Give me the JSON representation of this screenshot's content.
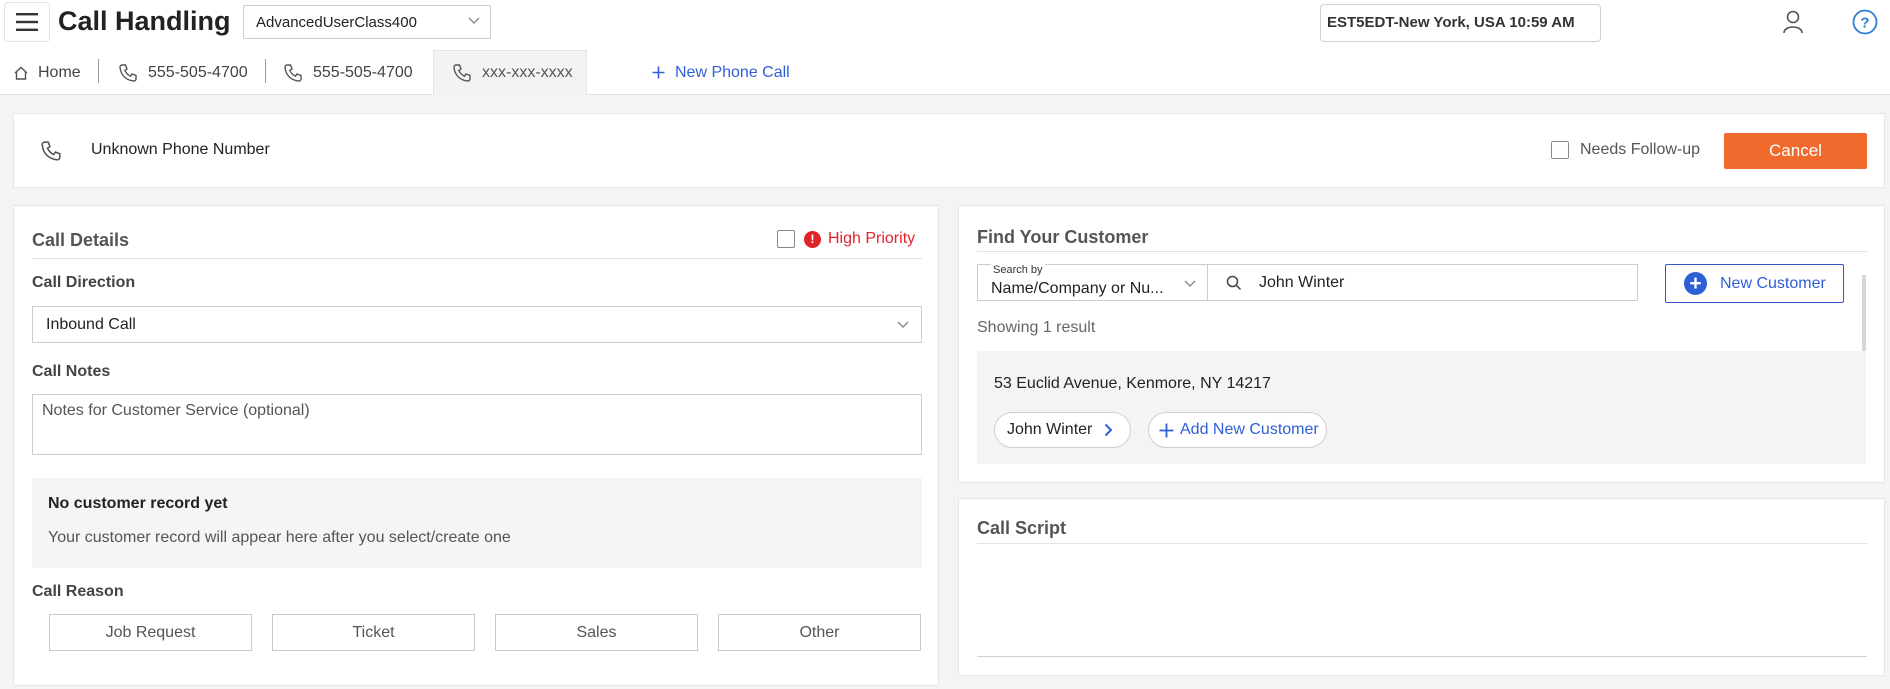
{
  "app": {
    "title": "Call Handling",
    "user_select": "AdvancedUserClass400",
    "timezone": "EST5EDT-New York, USA 10:59 AM"
  },
  "tabs": [
    {
      "label": "Home",
      "icon": "home-icon"
    },
    {
      "label": "555-505-4700",
      "icon": "phone-icon"
    },
    {
      "label": "555-505-4700",
      "icon": "phone-icon"
    },
    {
      "label": "xxx-xxx-xxxx",
      "icon": "phone-icon"
    }
  ],
  "new_call_label": "New Phone Call",
  "phone_bar": {
    "number_label": "Unknown Phone Number",
    "needs_followup_label": "Needs Follow-up",
    "cancel_label": "Cancel"
  },
  "call_details": {
    "title": "Call Details",
    "high_priority_label": "High Priority",
    "direction_label": "Call Direction",
    "direction_value": "Inbound Call",
    "notes_label": "Call Notes",
    "notes_placeholder": "Notes for Customer Service (optional)",
    "empty_title": "No customer record yet",
    "empty_text": "Your customer record will appear here after you select/create one",
    "reason_label": "Call Reason",
    "reasons": [
      "Job Request",
      "Ticket",
      "Sales",
      "Other"
    ]
  },
  "find_customer": {
    "title": "Find Your Customer",
    "search_by_caption": "Search by",
    "search_by_value": "Name/Company or Nu...",
    "search_value": "John Winter",
    "new_customer_label": "New Customer",
    "showing": "Showing 1 result",
    "result": {
      "address": "53 Euclid Avenue, Kenmore, NY 14217",
      "contact": "John Winter",
      "add_label": "Add New Customer"
    }
  },
  "call_script": {
    "title": "Call Script"
  },
  "colors": {
    "accent": "#2f5fd6",
    "cancel": "#f06a2e",
    "priority": "#e0242a"
  }
}
